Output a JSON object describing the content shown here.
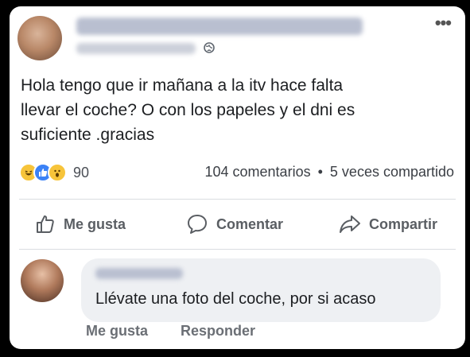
{
  "post": {
    "more_label": "•••",
    "text_lines": [
      "Hola tengo que ir mañana  a la  itv hace falta",
      "llevar el coche? O con los papeles y el dni es",
      "suficiente .gracias"
    ]
  },
  "stats": {
    "reaction_count": "90",
    "comments_label": "104 comentarios",
    "separator": "•",
    "shares_label": "5 veces compartido"
  },
  "actions": {
    "like_label": "Me gusta",
    "comment_label": "Comentar",
    "share_label": "Compartir"
  },
  "comment": {
    "text": "Llévate una foto del coche, por si acaso",
    "like_label": "Me gusta",
    "reply_label": "Responder"
  },
  "colors": {
    "background": "#ffffff",
    "text": "#1c1e21",
    "secondary_text": "#5a5e63",
    "comment_bubble": "#eef0f3",
    "like_blue": "#3b82f6",
    "reaction_yellow": "#f7c43a"
  }
}
